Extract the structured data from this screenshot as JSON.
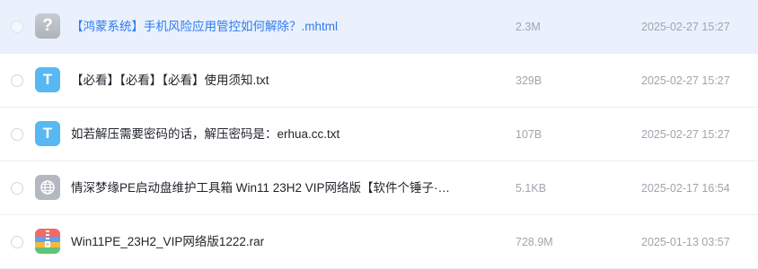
{
  "files": [
    {
      "icon": "unknown-file-icon",
      "icon_glyph": "?",
      "name": "【鸿蒙系统】手机风险应用管控如何解除？.mhtml",
      "size": "2.3M",
      "date": "2025-02-27 15:27",
      "selected": true
    },
    {
      "icon": "txt-file-icon",
      "icon_glyph": "T",
      "name": "【必看】【必看】【必看】使用须知.txt",
      "size": "329B",
      "date": "2025-02-27 15:27",
      "selected": false
    },
    {
      "icon": "txt-file-icon",
      "icon_glyph": "T",
      "name": "如若解压需要密码的话，解压密码是：erhua.cc.txt",
      "size": "107B",
      "date": "2025-02-27 15:27",
      "selected": false
    },
    {
      "icon": "globe-file-icon",
      "icon_glyph": "",
      "name": "情深梦缘PE启动盘维护工具箱 Win11 23H2 VIP网络版【软件个锤子·…",
      "size": "5.1KB",
      "date": "2025-02-17 16:54",
      "selected": false
    },
    {
      "icon": "rar-archive-icon",
      "icon_glyph": "",
      "name": "Win11PE_23H2_VIP网络版1222.rar",
      "size": "728.9M",
      "date": "2025-01-13 03:57",
      "selected": false
    }
  ],
  "colors": {
    "selected_row": "#eaf1fd",
    "selected_text": "#2f7bf0",
    "meta_text": "#a0a5ad",
    "txt_icon": "#57b8f2"
  }
}
